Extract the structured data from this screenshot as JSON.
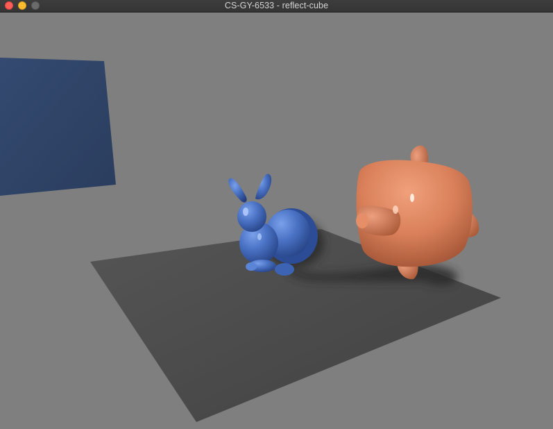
{
  "window": {
    "title": "CS-GY-6533 - reflect-cube"
  },
  "controls": {
    "close_icon": "close-icon",
    "minimize_icon": "minimize-icon",
    "zoom_icon": "zoom-icon",
    "close_color": "#ff5f57",
    "minimize_color": "#febc2e",
    "zoom_color": "#6b6b6b"
  },
  "scene": {
    "background_color": "#7f7f7f",
    "floor_color": "#4a4a4a",
    "wall_color": "#2f4467",
    "bunny_color": "#4a72c4",
    "blob_color": "#d9805a"
  }
}
